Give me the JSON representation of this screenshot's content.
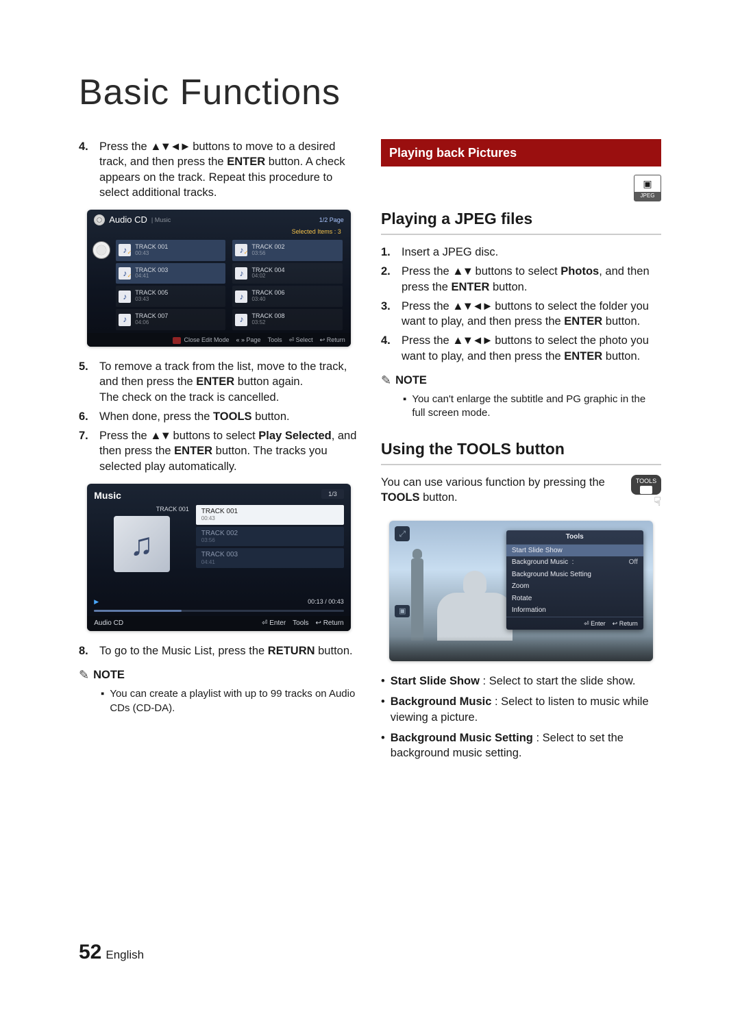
{
  "chapter_title": "Basic Functions",
  "left": {
    "step4": {
      "num": "4.",
      "text_a": "Press the ",
      "arrows": "▲▼◄►",
      "text_b": " buttons to move to a desired track, and then press the ",
      "enter": "ENTER",
      "text_c": " button. A check appears on the track. Repeat this procedure to select additional tracks."
    },
    "ss1": {
      "title": "Audio CD",
      "subtitle": "| Music",
      "page": "1/2 Page",
      "selected": "Selected Items : 3",
      "tracks": [
        {
          "name": "TRACK 001",
          "time": "00:43",
          "sel": true
        },
        {
          "name": "TRACK 002",
          "time": "03:56",
          "sel": true
        },
        {
          "name": "TRACK 003",
          "time": "04:41",
          "sel": true
        },
        {
          "name": "TRACK 004",
          "time": "04:02",
          "sel": false
        },
        {
          "name": "TRACK 005",
          "time": "03:43",
          "sel": false
        },
        {
          "name": "TRACK 006",
          "time": "03:40",
          "sel": false
        },
        {
          "name": "TRACK 007",
          "time": "04:06",
          "sel": false
        },
        {
          "name": "TRACK 008",
          "time": "03:52",
          "sel": false
        }
      ],
      "foot_close": "Close Edit Mode",
      "foot_page": "Page",
      "foot_tools": "Tools",
      "foot_select": "Select",
      "foot_return": "Return"
    },
    "step5": {
      "num": "5.",
      "text_a": "To remove a track from the list, move to the track, and then press the ",
      "enter": "ENTER",
      "text_b": " button again.",
      "text_c": "The check on the track is cancelled."
    },
    "step6": {
      "num": "6.",
      "text_a": "When done, press the ",
      "tools": "TOOLS",
      "text_b": " button."
    },
    "step7": {
      "num": "7.",
      "text_a": "Press the ",
      "arrows": "▲▼",
      "text_b": " buttons to select ",
      "play": "Play Selected",
      "text_c": ", and then press the ",
      "enter": "ENTER",
      "text_d": " button. The tracks you selected play automatically."
    },
    "ss2": {
      "title": "Music",
      "page": "1/3",
      "nowtrack": "TRACK 001",
      "items": [
        {
          "name": "TRACK 001",
          "time": "00:43"
        },
        {
          "name": "TRACK 002",
          "time": "03:56"
        },
        {
          "name": "TRACK 003",
          "time": "04:41"
        }
      ],
      "progress": "00:13 / 00:43",
      "foot_src": "Audio CD",
      "foot_enter": "Enter",
      "foot_tools": "Tools",
      "foot_return": "Return"
    },
    "step8": {
      "num": "8.",
      "text_a": "To go to the Music List, press the ",
      "ret": "RETURN",
      "text_b": " button."
    },
    "note_label": "NOTE",
    "note_item": "You can create a playlist with up to 99 tracks on Audio CDs (CD-DA)."
  },
  "right": {
    "banner": "Playing back Pictures",
    "jpeg": {
      "icon": "▣",
      "label": "JPEG"
    },
    "h2a": "Playing a JPEG files",
    "r1": {
      "num": "1.",
      "text": "Insert a JPEG disc."
    },
    "r2": {
      "num": "2.",
      "text_a": "Press the ",
      "arrows": "▲▼",
      "text_b": " buttons to select ",
      "photos": "Photos",
      "text_c": ", and then press the ",
      "enter": "ENTER",
      "text_d": " button."
    },
    "r3": {
      "num": "3.",
      "text_a": "Press the ",
      "arrows": "▲▼◄►",
      "text_b": " buttons to select the folder you want to play, and then press the ",
      "enter": "ENTER",
      "text_c": " button."
    },
    "r4": {
      "num": "4.",
      "text_a": "Press the ",
      "arrows": "▲▼◄►",
      "text_b": " buttons to select the photo you want to play, and then press the ",
      "enter": "ENTER",
      "text_c": " button."
    },
    "note_label": "NOTE",
    "note_item": "You can't enlarge the subtitle and PG graphic in the full screen mode.",
    "h2b": "Using the TOOLS button",
    "tools_intro_a": "You can use various function by pressing the ",
    "tools_b": "TOOLS",
    "tools_intro_b": " button.",
    "tools_icon_label": "TOOLS",
    "ss3": {
      "head": "Tools",
      "items": [
        {
          "label": "Start Slide Show",
          "val": ""
        },
        {
          "label": "Background Music",
          "val": "Off"
        },
        {
          "label": "Background Music Setting",
          "val": ""
        },
        {
          "label": "Zoom",
          "val": ""
        },
        {
          "label": "Rotate",
          "val": ""
        },
        {
          "label": "Information",
          "val": ""
        }
      ],
      "foot_enter": "Enter",
      "foot_return": "Return"
    },
    "b1": {
      "bold": "Start Slide Show",
      "rest": " : Select to start the slide show."
    },
    "b2": {
      "bold": "Background Music",
      "rest": " : Select to listen to music while viewing a picture."
    },
    "b3": {
      "bold": "Background Music Setting",
      "rest": " : Select to set the background music setting."
    }
  },
  "footer": {
    "page": "52",
    "lang": "English"
  }
}
